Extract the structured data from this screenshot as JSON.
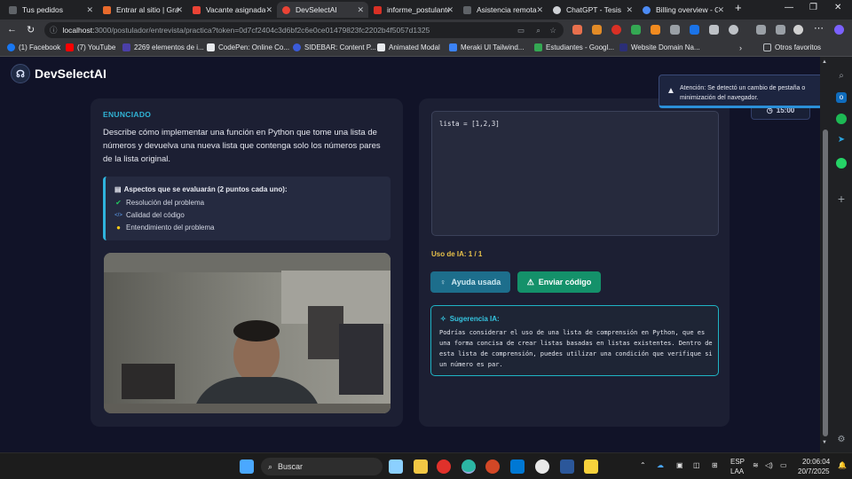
{
  "browser": {
    "tabs": [
      {
        "title": "Tus pedidos",
        "color": "#5f6368"
      },
      {
        "title": "Entrar al sitio | Gra",
        "color": "#e86a2c"
      },
      {
        "title": "Vacante asignada",
        "color": "#ea4335"
      },
      {
        "title": "DevSelectAI",
        "color": "#ea4335",
        "active": true
      },
      {
        "title": "informe_postulante",
        "color": "#d93025"
      },
      {
        "title": "Asistencia remota",
        "color": "#5f6368"
      },
      {
        "title": "ChatGPT - Tesis",
        "color": "#cfd2d6"
      },
      {
        "title": "Billing overview - G",
        "color": "#4c8bf5"
      }
    ],
    "url_host": "localhost:",
    "url_path": "3000/postulador/entrevista/practica?token=0d7cf2404c3d6bf2c6e0ce01479823fc2202b4f5057d1325",
    "bookmarks": [
      {
        "label": "(1) Facebook",
        "color": "#1877f2"
      },
      {
        "label": "(7) YouTube",
        "color": "#ff0000"
      },
      {
        "label": "2269 elementos de i...",
        "color": "#4b3fa8"
      },
      {
        "label": "CodePen: Online Co...",
        "color": "#e8eaed"
      },
      {
        "label": "SIDEBAR: Content P...",
        "color": "#3b5bd9"
      },
      {
        "label": "Animated Modal",
        "color": "#e8eaed"
      },
      {
        "label": "Meraki UI Tailwind...",
        "color": "#3b82f6"
      },
      {
        "label": "Estudiantes - Googl...",
        "color": "#34a853"
      },
      {
        "label": "Website Domain Na...",
        "color": "#2b2f77"
      }
    ],
    "other_bookmarks": "Otros favoritos"
  },
  "app": {
    "brand": "DevSelectAI",
    "enunciado_label": "ENUNCIADO",
    "enunciado": "Describe cómo implementar una función en Python que tome una lista de números y devuelva una nueva lista que contenga solo los números pares de la lista original.",
    "aspects_title": "Aspectos que se evaluarán (2 puntos cada uno):",
    "aspects": [
      {
        "label": "Resolución del problema",
        "icon": "check-circle-icon",
        "color": "#22c55e",
        "glyph": "✔"
      },
      {
        "label": "Calidad del código",
        "icon": "code-icon",
        "color": "#60a5fa",
        "glyph": "</>"
      },
      {
        "label": "Entendimiento del problema",
        "icon": "lightbulb-icon",
        "color": "#facc15",
        "glyph": "💡"
      }
    ],
    "code": "lista = [1,2,3]",
    "ia_usage": "Uso de IA: 1 / 1",
    "help_button": "Ayuda usada",
    "submit_button": "Enviar código",
    "suggestion_title": "Sugerencia IA:",
    "suggestion": "Podrías considerar el uso de una lista de comprensión en Python, que es una forma concisa de crear listas basadas en listas existentes. Dentro de esta lista de comprensión, puedes utilizar una condición que verifique si un número es par.",
    "toast": "Atención: Se detectó un cambio de pestaña o minimización del navegador.",
    "timer": "15:00"
  },
  "taskbar": {
    "search_placeholder": "Buscar",
    "lang": "ESP",
    "layout": "LAA",
    "time": "20:06:04",
    "date": "20/7/2025"
  }
}
